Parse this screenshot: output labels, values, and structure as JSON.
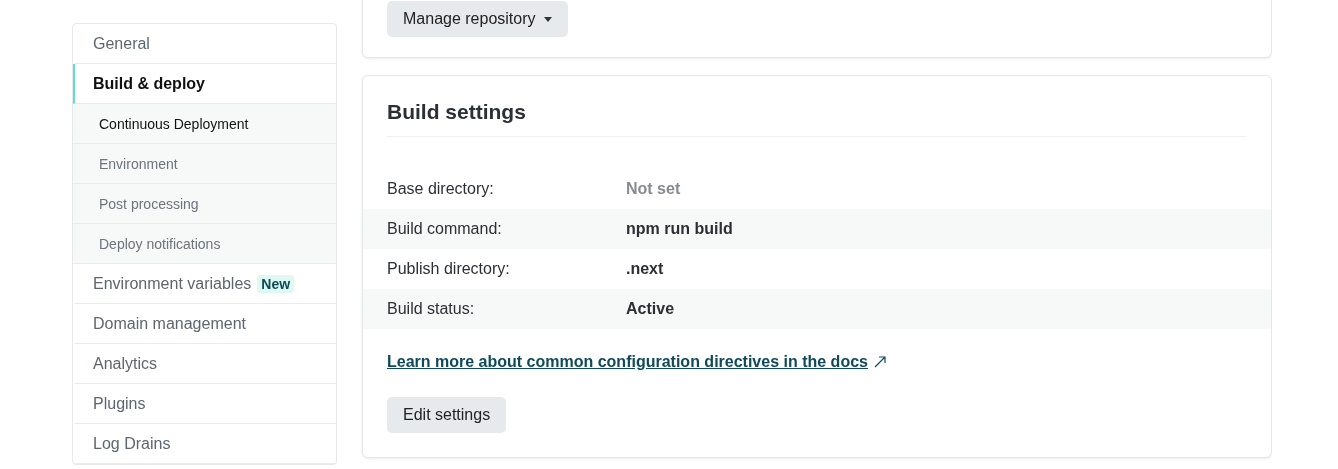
{
  "sidebar": {
    "items": [
      {
        "label": "General",
        "selected": false
      },
      {
        "label": "Build & deploy",
        "selected": true,
        "children": [
          {
            "label": "Continuous Deployment",
            "selected": true
          },
          {
            "label": "Environment",
            "selected": false
          },
          {
            "label": "Post processing",
            "selected": false
          },
          {
            "label": "Deploy notifications",
            "selected": false
          }
        ]
      },
      {
        "label": "Environment variables",
        "selected": false,
        "badge": "New"
      },
      {
        "label": "Domain management",
        "selected": false
      },
      {
        "label": "Analytics",
        "selected": false
      },
      {
        "label": "Plugins",
        "selected": false
      },
      {
        "label": "Log Drains",
        "selected": false
      }
    ]
  },
  "repository_card": {
    "button": "Manage repository"
  },
  "build_settings": {
    "title": "Build settings",
    "rows": [
      {
        "label": "Base directory:",
        "value": "Not set",
        "muted": true
      },
      {
        "label": "Build command:",
        "value": "npm run build",
        "muted": false
      },
      {
        "label": "Publish directory:",
        "value": ".next",
        "muted": false
      },
      {
        "label": "Build status:",
        "value": "Active",
        "muted": false
      }
    ],
    "link": "Learn more about common configuration directives in the docs",
    "button": "Edit settings"
  }
}
